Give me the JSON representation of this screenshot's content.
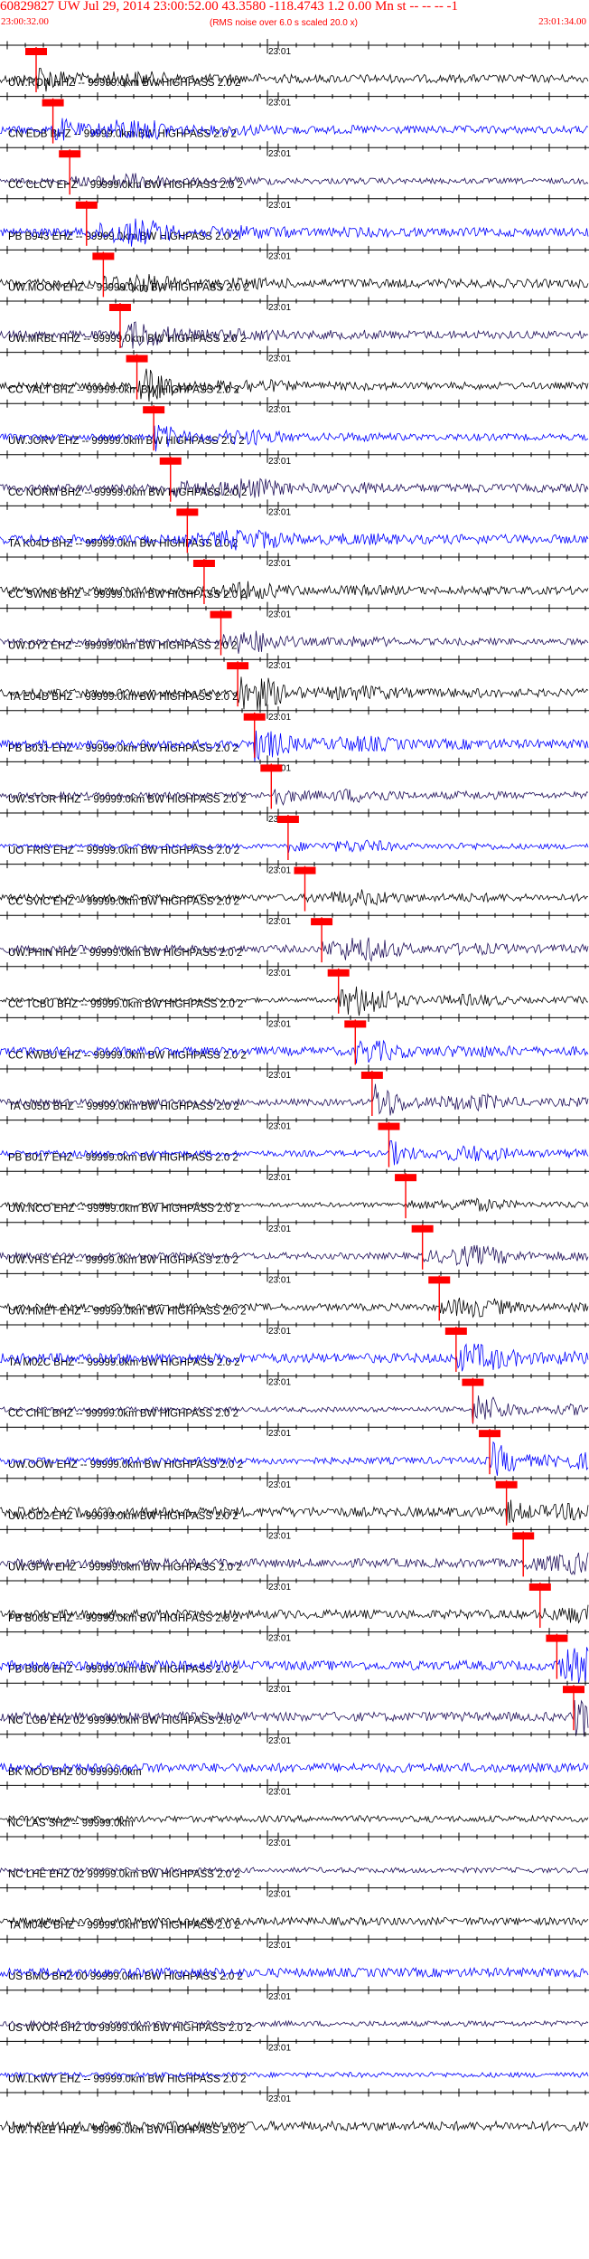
{
  "header": {
    "title": "60829827 UW Jul 29, 2014 23:00:52.00   43.3580 -118.4743  1.2 0.00 Mn st -- -- --  -1",
    "start_time": "23:00:32.00",
    "note": "(RMS noise over 6.0 s scaled 20.0 x)",
    "end_time": "23:01:34.00"
  },
  "chart_data": {
    "type": "seismogram",
    "title": "60829827 UW Jul 29, 2014 23:00:52.00",
    "x_range": [
      "23:00:32.00",
      "23:01:34.00"
    ],
    "minute_tick_label": "23:01",
    "traces": [
      {
        "label": "UW.RON HHZ -- 99999.0km BW  HIGHPASS  2.0  2",
        "pick": true
      },
      {
        "label": "CN EDB BHZ -- 99999.0km BW  HIGHPASS  2.0  2",
        "pick": true
      },
      {
        "label": "CC CLCV EHZ -- 99999.0km BW  HIGHPASS  2.0  2",
        "pick": true
      },
      {
        "label": "PB B943 EHZ -- 99999.0km BW  HIGHPASS  2.0  2",
        "pick": true
      },
      {
        "label": "UW.MOON EHZ -- 99999.0km BW  HIGHPASS  2.0  2",
        "pick": true
      },
      {
        "label": "UW.MRBL HHZ -- 99999.0km BW  HIGHPASS  2.0  2",
        "pick": true
      },
      {
        "label": "CC VALT BHZ -- 99999.0km BW  HIGHPASS  2.0  2",
        "pick": true
      },
      {
        "label": "UW.JORV EHZ -- 99999.0km BW  HIGHPASS  2.0  2",
        "pick": true
      },
      {
        "label": "CC NORM BHZ -- 99999.0km BW  HIGHPASS  2.0  2",
        "pick": true
      },
      {
        "label": "TA K04D BHZ -- 99999.0km BW  HIGHPASS  2.0  2",
        "pick": true
      },
      {
        "label": "CC SWNB BHZ -- 99999.0km BW  HIGHPASS  2.0  2",
        "pick": true
      },
      {
        "label": "UW.DY2 EHZ -- 99999.0km BW  HIGHPASS  2.0  2",
        "pick": true
      },
      {
        "label": "TA E04D BHZ -- 99999.0km BW  HIGHPASS  2.0  2",
        "pick": true
      },
      {
        "label": "PB B031 EHZ -- 99999.0km BW  HIGHPASS  2.0  2",
        "pick": true
      },
      {
        "label": "UW.STOR HHZ -- 99999.0km BW  HIGHPASS  2.0  2",
        "pick": true
      },
      {
        "label": "UO FRIS EHZ -- 99999.0km BW  HIGHPASS  2.0  2",
        "pick": true
      },
      {
        "label": "CC SVIC EHZ -- 99999.0km BW  HIGHPASS  2.0  2",
        "pick": true
      },
      {
        "label": "UW.PHIN HHZ -- 99999.0km BW  HIGHPASS  2.0  2",
        "pick": true
      },
      {
        "label": "CC TCBU BHZ -- 99999.0km BW  HIGHPASS  2.0  2",
        "pick": true
      },
      {
        "label": "CC KWBU EHZ -- 99999.0km BW  HIGHPASS  2.0  2",
        "pick": true
      },
      {
        "label": "TA G05D BHZ -- 99999.0km BW  HIGHPASS  2.0  2",
        "pick": true
      },
      {
        "label": "PB B017 EHZ -- 99999.0km BW  HIGHPASS  2.0  2",
        "pick": true
      },
      {
        "label": "UW.NCO EHZ -- 99999.0km BW  HIGHPASS  2.0  2",
        "pick": true
      },
      {
        "label": "UW.VHS EHZ -- 99999.0km BW  HIGHPASS  2.0  2",
        "pick": true
      },
      {
        "label": "UW.HMET EHZ -- 99999.0km BW  HIGHPASS  2.0  2",
        "pick": true
      },
      {
        "label": "TA M02C BHZ -- 99999.0km BW  HIGHPASS  2.0  2",
        "pick": true
      },
      {
        "label": "CC CIHL BHZ -- 99999.0km BW  HIGHPASS  2.0  2",
        "pick": true
      },
      {
        "label": "UW.OOW EHZ -- 99999.0km BW  HIGHPASS  2.0  2",
        "pick": true
      },
      {
        "label": "UW.OD2 EHZ -- 99999.0km BW  HIGHPASS  2.0  2",
        "pick": true
      },
      {
        "label": "UW.GPW EHZ -- 99999.0km BW  HIGHPASS  2.0  2",
        "pick": true
      },
      {
        "label": "PB B005 EHZ -- 99999.0km BW  HIGHPASS  2.0  2",
        "pick": true
      },
      {
        "label": "PB B006 EHZ -- 99999.0km BW  HIGHPASS  2.0  2",
        "pick": true
      },
      {
        "label": "NC LGB EHZ 02 99999.0km BW  HIGHPASS  2.0  2",
        "pick": true
      },
      {
        "label": "BK MOD BHZ 00 99999.0km",
        "pick": false
      },
      {
        "label": "NC LAS SHZ -- 99999.0km",
        "pick": false
      },
      {
        "label": "NC LHE EHZ 02 99999.0km BW  HIGHPASS  2.0  2",
        "pick": false
      },
      {
        "label": "TA M04C BHZ -- 99999.0km BW  HIGHPASS  2.0  2",
        "pick": false
      },
      {
        "label": "US BMO BHZ 00 99999.0km BW  HIGHPASS  2.0  2",
        "pick": false
      },
      {
        "label": "US WVOR BHZ 00 99999.0km BW  HIGHPASS  2.0  2",
        "pick": false
      },
      {
        "label": "UW.LKWY EHZ -- 99999.0km BW  HIGHPASS  2.0  2",
        "pick": false
      },
      {
        "label": "UW.TREE HHZ -- 99999.0km BW  HIGHPASS  2.0  2",
        "pick": false
      }
    ]
  }
}
